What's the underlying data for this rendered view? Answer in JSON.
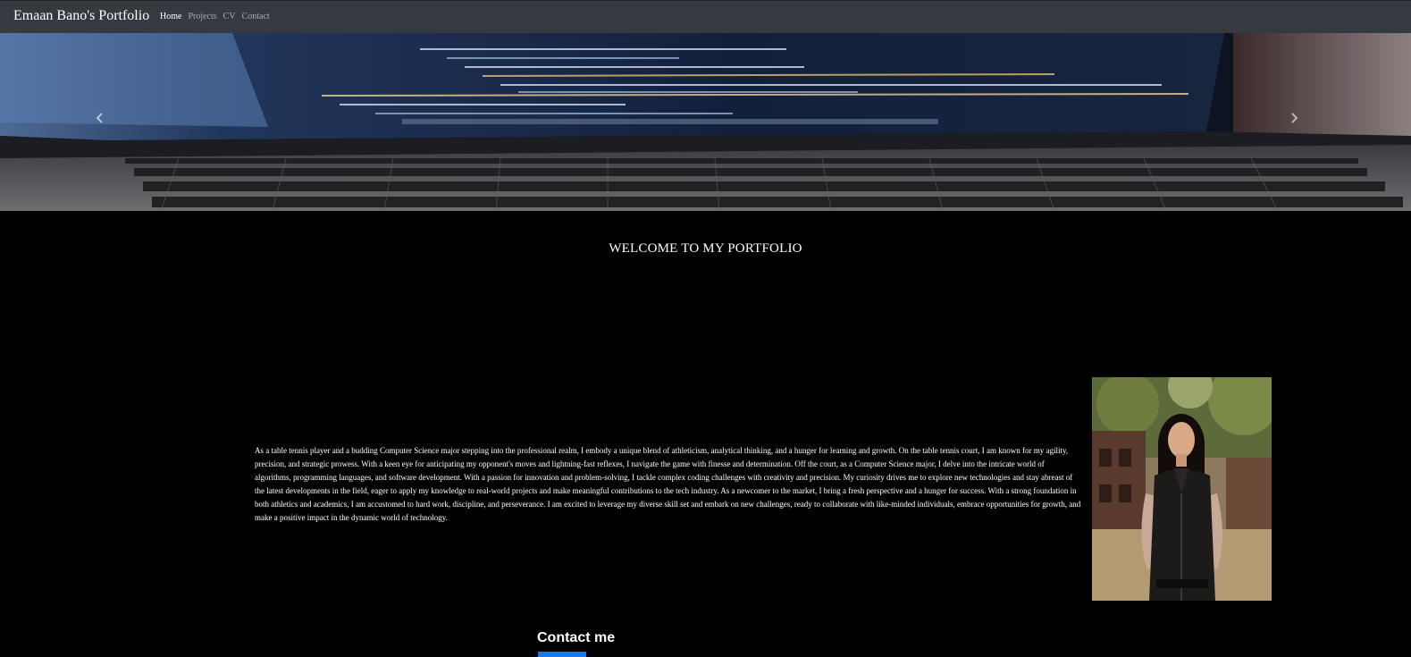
{
  "navbar": {
    "brand": "Emaan Bano's Portfolio",
    "links": [
      {
        "label": "Home",
        "active": true
      },
      {
        "label": "Projects",
        "active": false
      },
      {
        "label": "CV",
        "active": false
      },
      {
        "label": "Contact",
        "active": false
      }
    ]
  },
  "carousel": {
    "prev_icon": "chevron-left-icon",
    "next_icon": "chevron-right-icon"
  },
  "welcome": {
    "title": "WELCOME TO MY PORTFOLIO"
  },
  "about": {
    "text": "As a table tennis player and a budding Computer Science major stepping into the professional realm, I embody a unique blend of athleticism, analytical thinking, and a hunger for learning and growth. On the table tennis court, I am known for my agility, precision, and strategic prowess. With a keen eye for anticipating my opponent's moves and lightning-fast reflexes, I navigate the game with finesse and determination. Off the court, as a Computer Science major, I delve into the intricate world of algorithms, programming languages, and software development. With a passion for innovation and problem-solving, I tackle complex coding challenges with creativity and precision. My curiosity drives me to explore new technologies and stay abreast of the latest developments in the field, eager to apply my knowledge to real-world projects and make meaningful contributions to the tech industry. As a newcomer to the market, I bring a fresh perspective and a hunger for success. With a strong foundation in both athletics and academics, I am accustomed to hard work, discipline, and perseverance. I am excited to leverage my diverse skill set and embark on new challenges, ready to collaborate with like-minded individuals, embrace opportunities for growth, and make a positive impact in the dynamic world of technology."
  },
  "contact": {
    "title": "Contact me"
  },
  "colors": {
    "navbar_bg": "#343a40",
    "page_bg": "#000000",
    "accent": "#1b78e2"
  }
}
